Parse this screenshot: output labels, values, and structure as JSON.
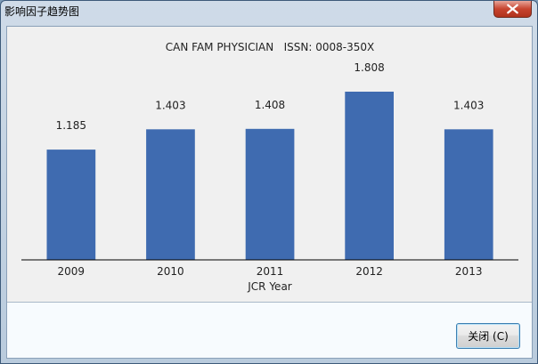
{
  "window": {
    "title": "影响因子趋势图",
    "close_button_label": "关闭 (C)"
  },
  "icons": {
    "close": "close-x-icon"
  },
  "colors": {
    "bar": "#3f6bb0",
    "axis": "#000000",
    "text": "#222222"
  },
  "chart_data": {
    "type": "bar",
    "title": "CAN FAM PHYSICIAN   ISSN: 0008-350X",
    "xlabel": "JCR Year",
    "ylabel": "",
    "categories": [
      "2009",
      "2010",
      "2011",
      "2012",
      "2013"
    ],
    "values": [
      1.185,
      1.403,
      1.408,
      1.808,
      1.403
    ],
    "data_labels": [
      "1.185",
      "1.403",
      "1.408",
      "1.808",
      "1.403"
    ],
    "ylim": [
      0,
      1.808
    ],
    "grid": false,
    "legend": "none"
  }
}
